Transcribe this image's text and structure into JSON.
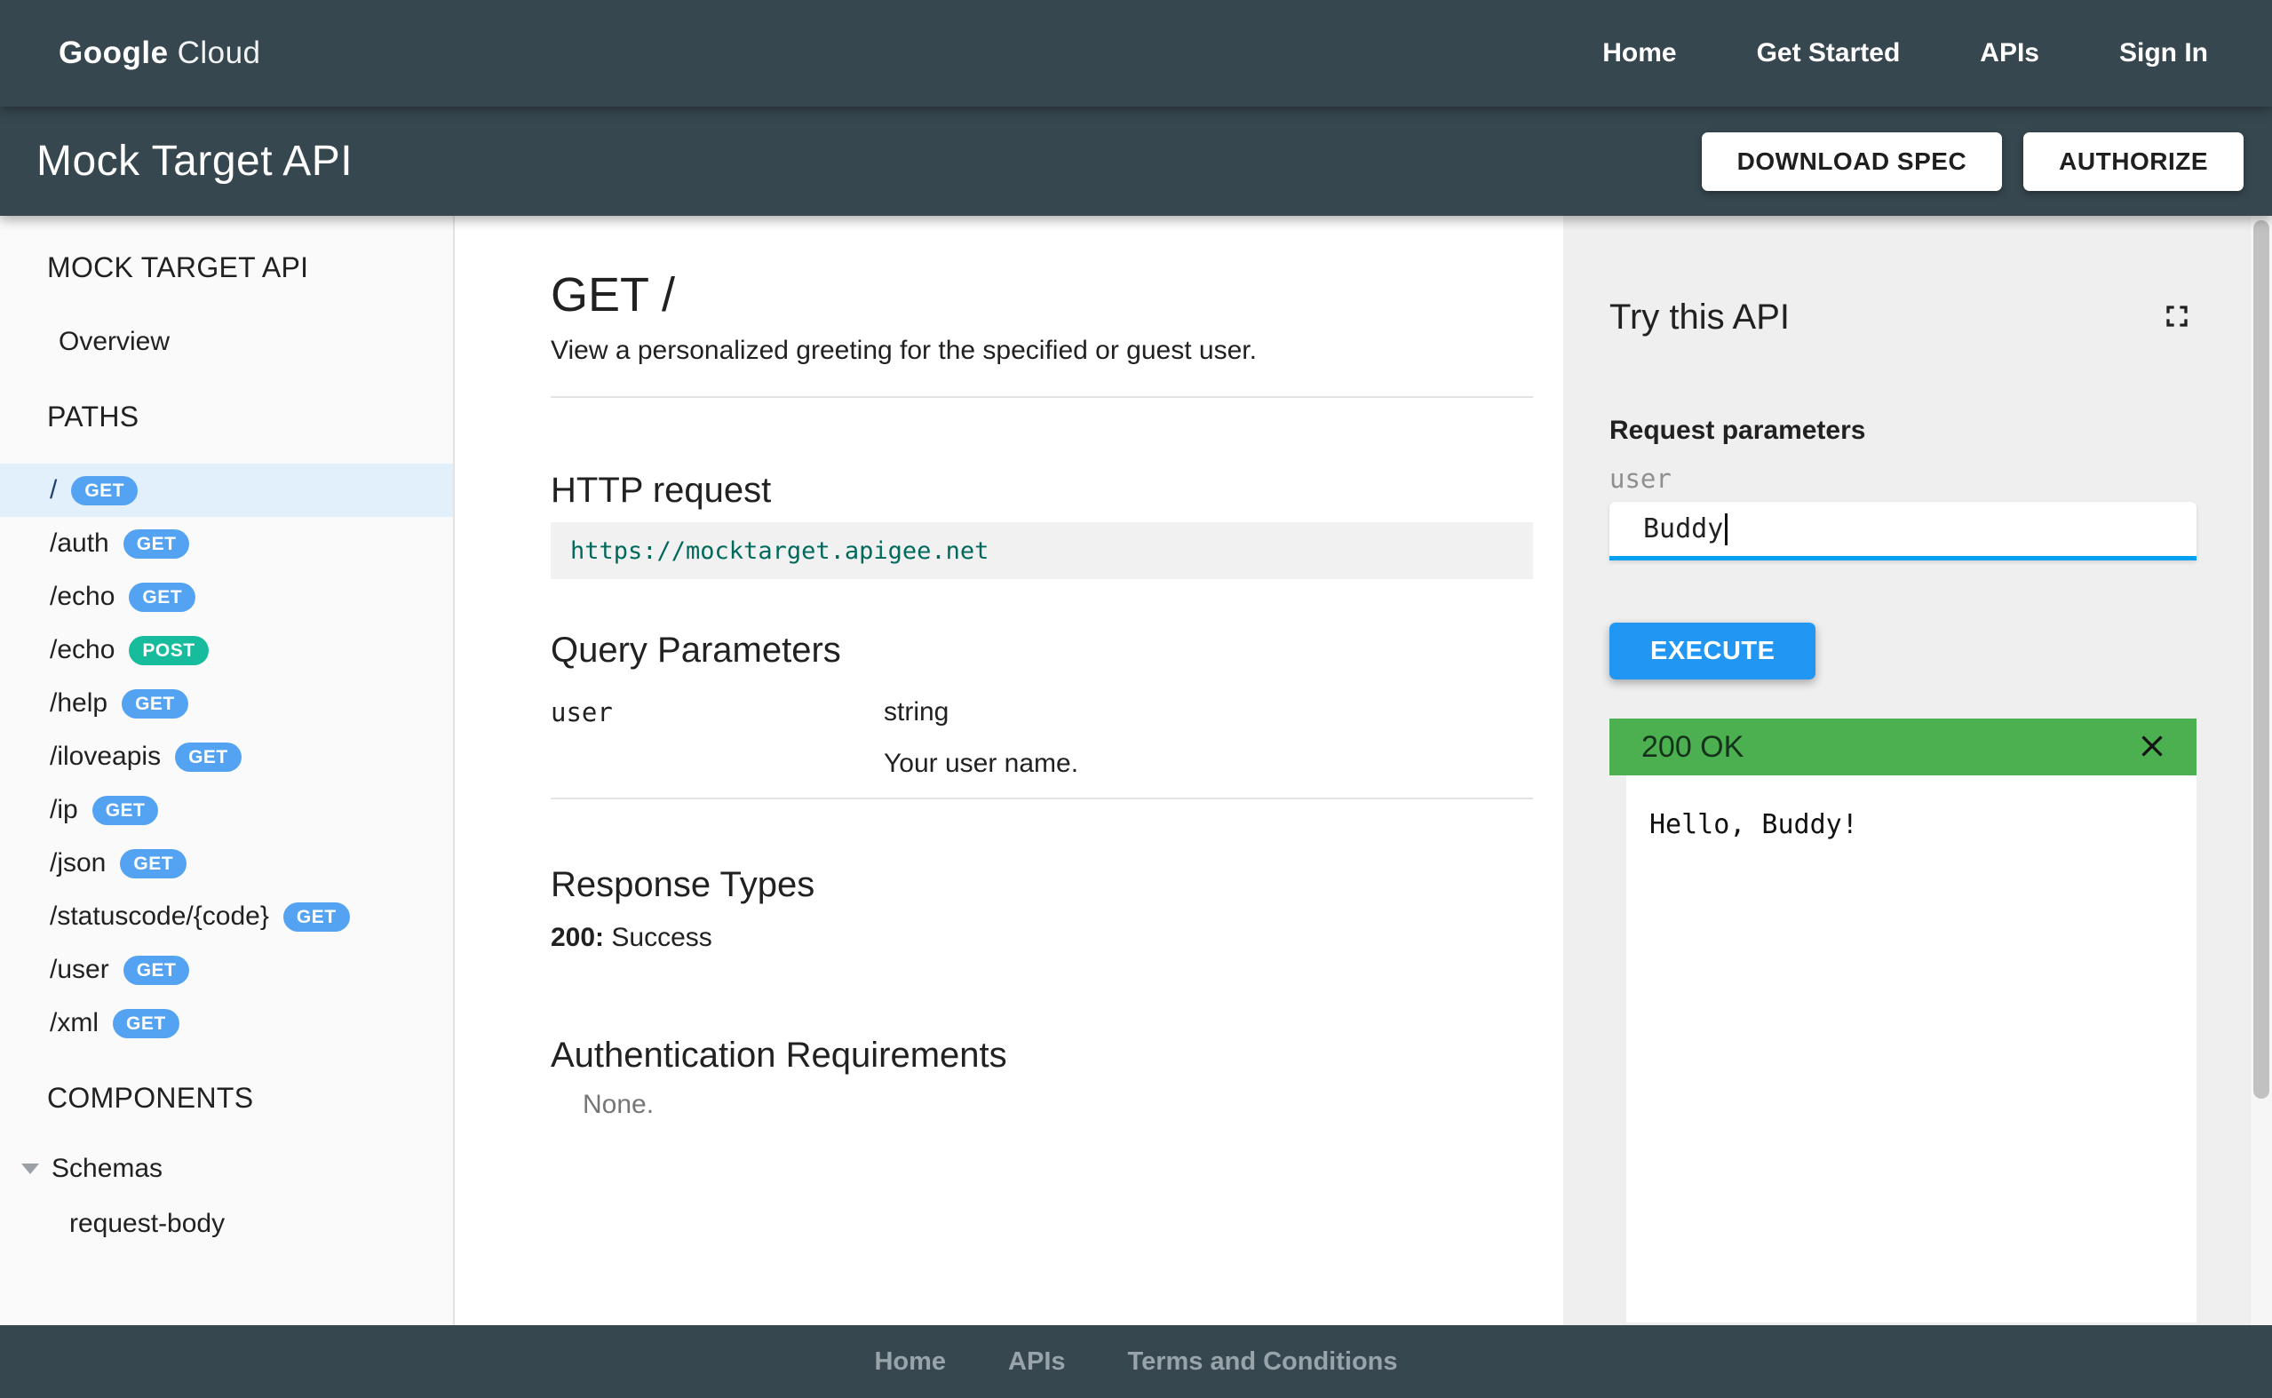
{
  "topnav": {
    "logo_google": "Google",
    "logo_cloud": "Cloud",
    "links": [
      {
        "label": "Home"
      },
      {
        "label": "Get Started"
      },
      {
        "label": "APIs"
      },
      {
        "label": "Sign In"
      }
    ]
  },
  "hero": {
    "title": "Mock Target API",
    "download_spec_label": "DOWNLOAD SPEC",
    "authorize_label": "AUTHORIZE"
  },
  "sidebar": {
    "api_title": "MOCK TARGET API",
    "overview_label": "Overview",
    "paths_header": "PATHS",
    "items": [
      {
        "path": "/",
        "method": "GET",
        "active": true
      },
      {
        "path": "/auth",
        "method": "GET"
      },
      {
        "path": "/echo",
        "method": "GET"
      },
      {
        "path": "/echo",
        "method": "POST"
      },
      {
        "path": "/help",
        "method": "GET"
      },
      {
        "path": "/iloveapis",
        "method": "GET"
      },
      {
        "path": "/ip",
        "method": "GET"
      },
      {
        "path": "/json",
        "method": "GET"
      },
      {
        "path": "/statuscode/{code}",
        "method": "GET"
      },
      {
        "path": "/user",
        "method": "GET"
      },
      {
        "path": "/xml",
        "method": "GET"
      }
    ],
    "components_header": "COMPONENTS",
    "schemas_label": "Schemas",
    "schema_items": [
      {
        "label": "request-body"
      }
    ]
  },
  "main": {
    "title": "GET /",
    "description": "View a personalized greeting for the specified or guest user.",
    "http_request_heading": "HTTP request",
    "http_request_url": "https://mocktarget.apigee.net",
    "query_params_heading": "Query Parameters",
    "params": [
      {
        "name": "user",
        "type": "string",
        "description": "Your user name."
      }
    ],
    "response_types_heading": "Response Types",
    "response_types": [
      {
        "code": "200:",
        "label": "Success"
      }
    ],
    "auth_heading": "Authentication Requirements",
    "auth_value": "None."
  },
  "try_panel": {
    "title": "Try this API",
    "fullscreen_icon": "fullscreen-icon",
    "request_parameters_label": "Request parameters",
    "field": {
      "name": "user",
      "value": "Buddy"
    },
    "execute_label": "EXECUTE",
    "response": {
      "status": "200 OK",
      "body": "Hello, Buddy!"
    }
  },
  "footer": {
    "links": [
      {
        "label": "Home"
      },
      {
        "label": "APIs"
      },
      {
        "label": "Terms and Conditions"
      }
    ]
  },
  "colors": {
    "header_bg": "#37474f",
    "get_badge": "#54a3f3",
    "post_badge": "#17bc9c",
    "active_item_bg": "#e2f0fc",
    "execute_button": "#2196f3",
    "input_underline": "#00a0f2",
    "success_bar": "#4caf50",
    "code_url_teal": "#00695c"
  }
}
